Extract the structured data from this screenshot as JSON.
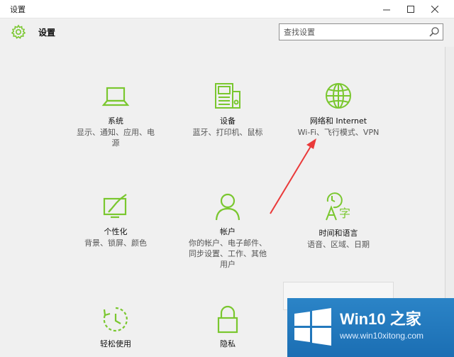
{
  "window": {
    "title": "设置",
    "app_title": "设置",
    "controls": [
      "minimize",
      "maximize",
      "close"
    ]
  },
  "search": {
    "placeholder": "查找设置"
  },
  "tiles": [
    {
      "name": "系统",
      "desc_lines": [
        "显示、通知、应用、电",
        "源"
      ],
      "icon": "laptop-icon"
    },
    {
      "name": "设备",
      "desc_lines": [
        "蓝牙、打印机、鼠标"
      ],
      "icon": "devices-icon"
    },
    {
      "name": "网络和 Internet",
      "desc_lines": [
        "Wi-Fi、飞行模式、VPN"
      ],
      "icon": "globe-icon"
    },
    {
      "name": "个性化",
      "desc_lines": [
        "背景、锁屏、颜色"
      ],
      "icon": "personalization-icon"
    },
    {
      "name": "帐户",
      "desc_lines": [
        "你的帐户、电子邮件、",
        "同步设置、工作、其他",
        "用户"
      ],
      "icon": "account-icon"
    },
    {
      "name": "时间和语言",
      "desc_lines": [
        "语音、区域、日期"
      ],
      "icon": "time-language-icon"
    },
    {
      "name": "轻松使用",
      "desc_lines": [],
      "icon": "ease-of-access-icon"
    },
    {
      "name": "隐私",
      "desc_lines": [],
      "icon": "lock-icon"
    }
  ],
  "watermark": {
    "title": "Win10 之家",
    "url": "www.win10xitong.com"
  },
  "colors": {
    "accent": "#7ac72f",
    "annotation_arrow": "#ea3a3a",
    "watermark_blue": "#1f73b8"
  }
}
